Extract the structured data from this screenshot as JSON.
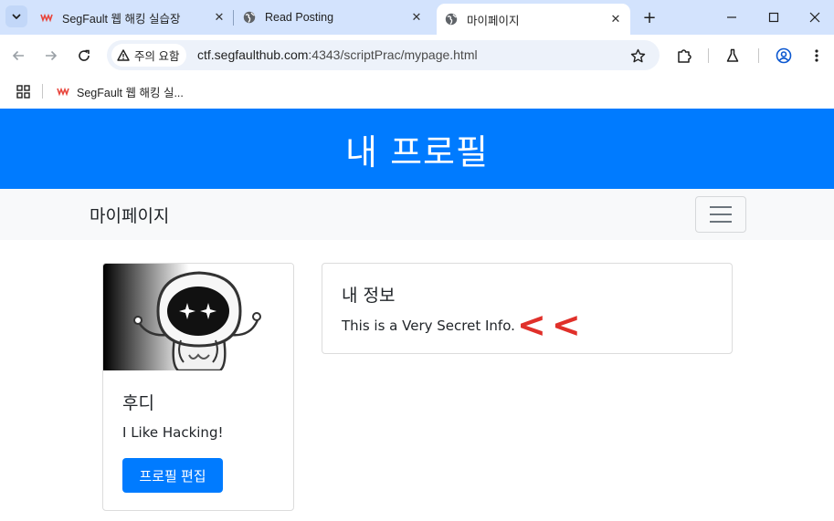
{
  "browser": {
    "tabs": [
      {
        "title": "SegFault 웹 해킹 실습장",
        "favicon": "segfault-icon",
        "active": false
      },
      {
        "title": "Read Posting",
        "favicon": "globe-icon",
        "active": false
      },
      {
        "title": "마이페이지",
        "favicon": "globe-icon",
        "active": true
      }
    ],
    "security_chip": "주의 요함",
    "url_host": "ctf.segfaulthub.com",
    "url_rest": ":4343/scriptPrac/mypage.html",
    "bookmarks": [
      {
        "label": "SegFault 웹 해킹 실...",
        "favicon": "segfault-icon"
      }
    ]
  },
  "page": {
    "header_title": "내 프로필",
    "navbar_brand": "마이페이지",
    "profile_card": {
      "name": "후디",
      "description": "I Like Hacking!",
      "edit_button": "프로필 편집"
    },
    "info_card": {
      "title": "내 정보",
      "text": "This is a Very Secret Info.",
      "annotation": "<<"
    }
  },
  "colors": {
    "primary": "#007bff",
    "annotation": "#e0302a",
    "tabstrip": "#d3e3fd",
    "navbar_bg": "#f8f9fa"
  }
}
